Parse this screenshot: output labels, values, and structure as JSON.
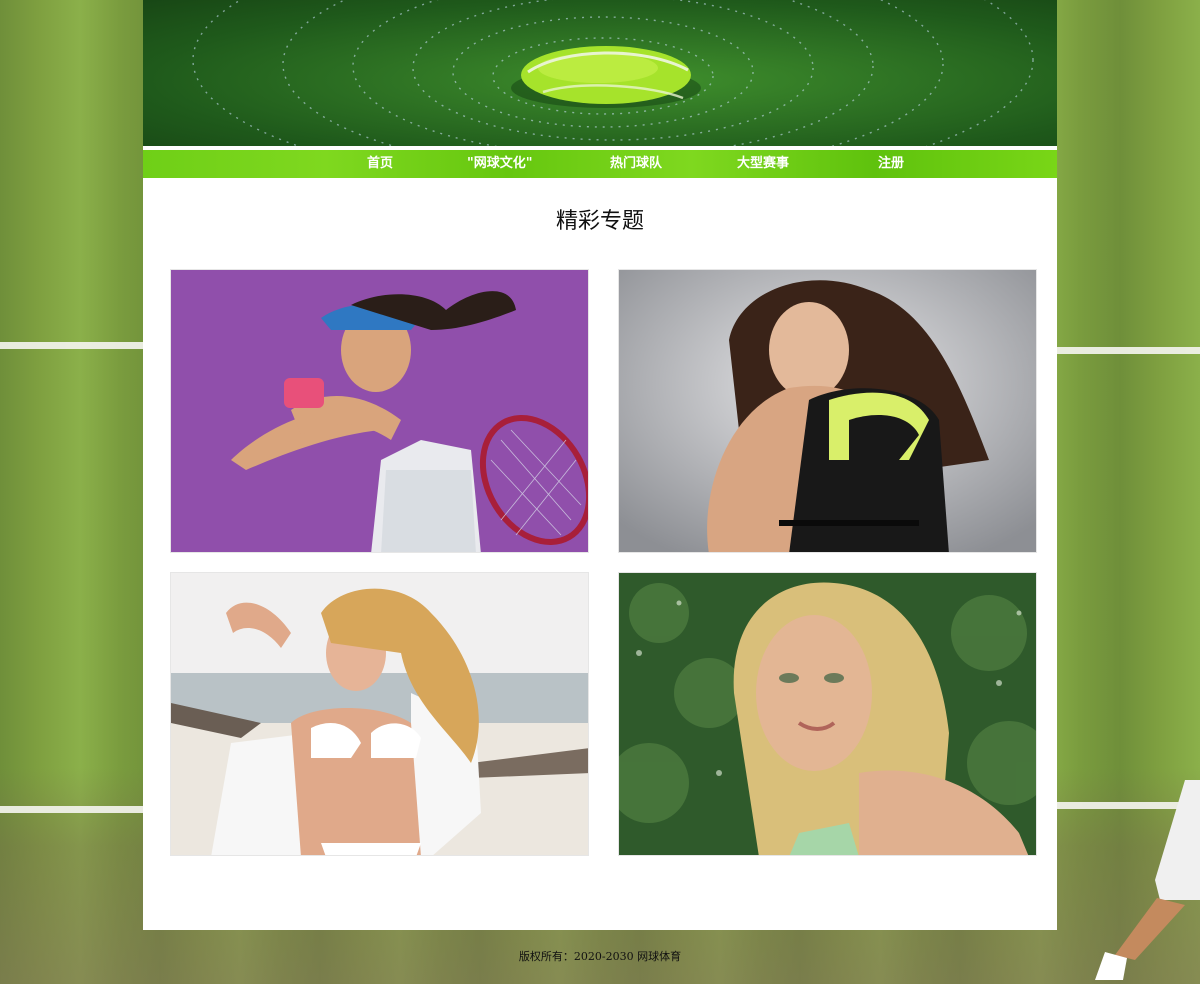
{
  "nav": {
    "items": [
      {
        "label": "首页"
      },
      {
        "label": "\"网球文化\""
      },
      {
        "label": "热门球队"
      },
      {
        "label": "大型赛事"
      },
      {
        "label": "注册"
      }
    ]
  },
  "main": {
    "section_title": "精彩专题",
    "photos": [
      {
        "icon": "tennis-player-photo"
      },
      {
        "icon": "portrait-photo"
      },
      {
        "icon": "beach-photo"
      },
      {
        "icon": "portrait-photo"
      }
    ]
  },
  "footer": {
    "copyright": "版权所有：2020-2030 网球体育"
  },
  "colors": {
    "nav_green": "#6fcf17",
    "banner_green": "#2f7424",
    "page_background": "#ffffff",
    "text": "#111111"
  }
}
